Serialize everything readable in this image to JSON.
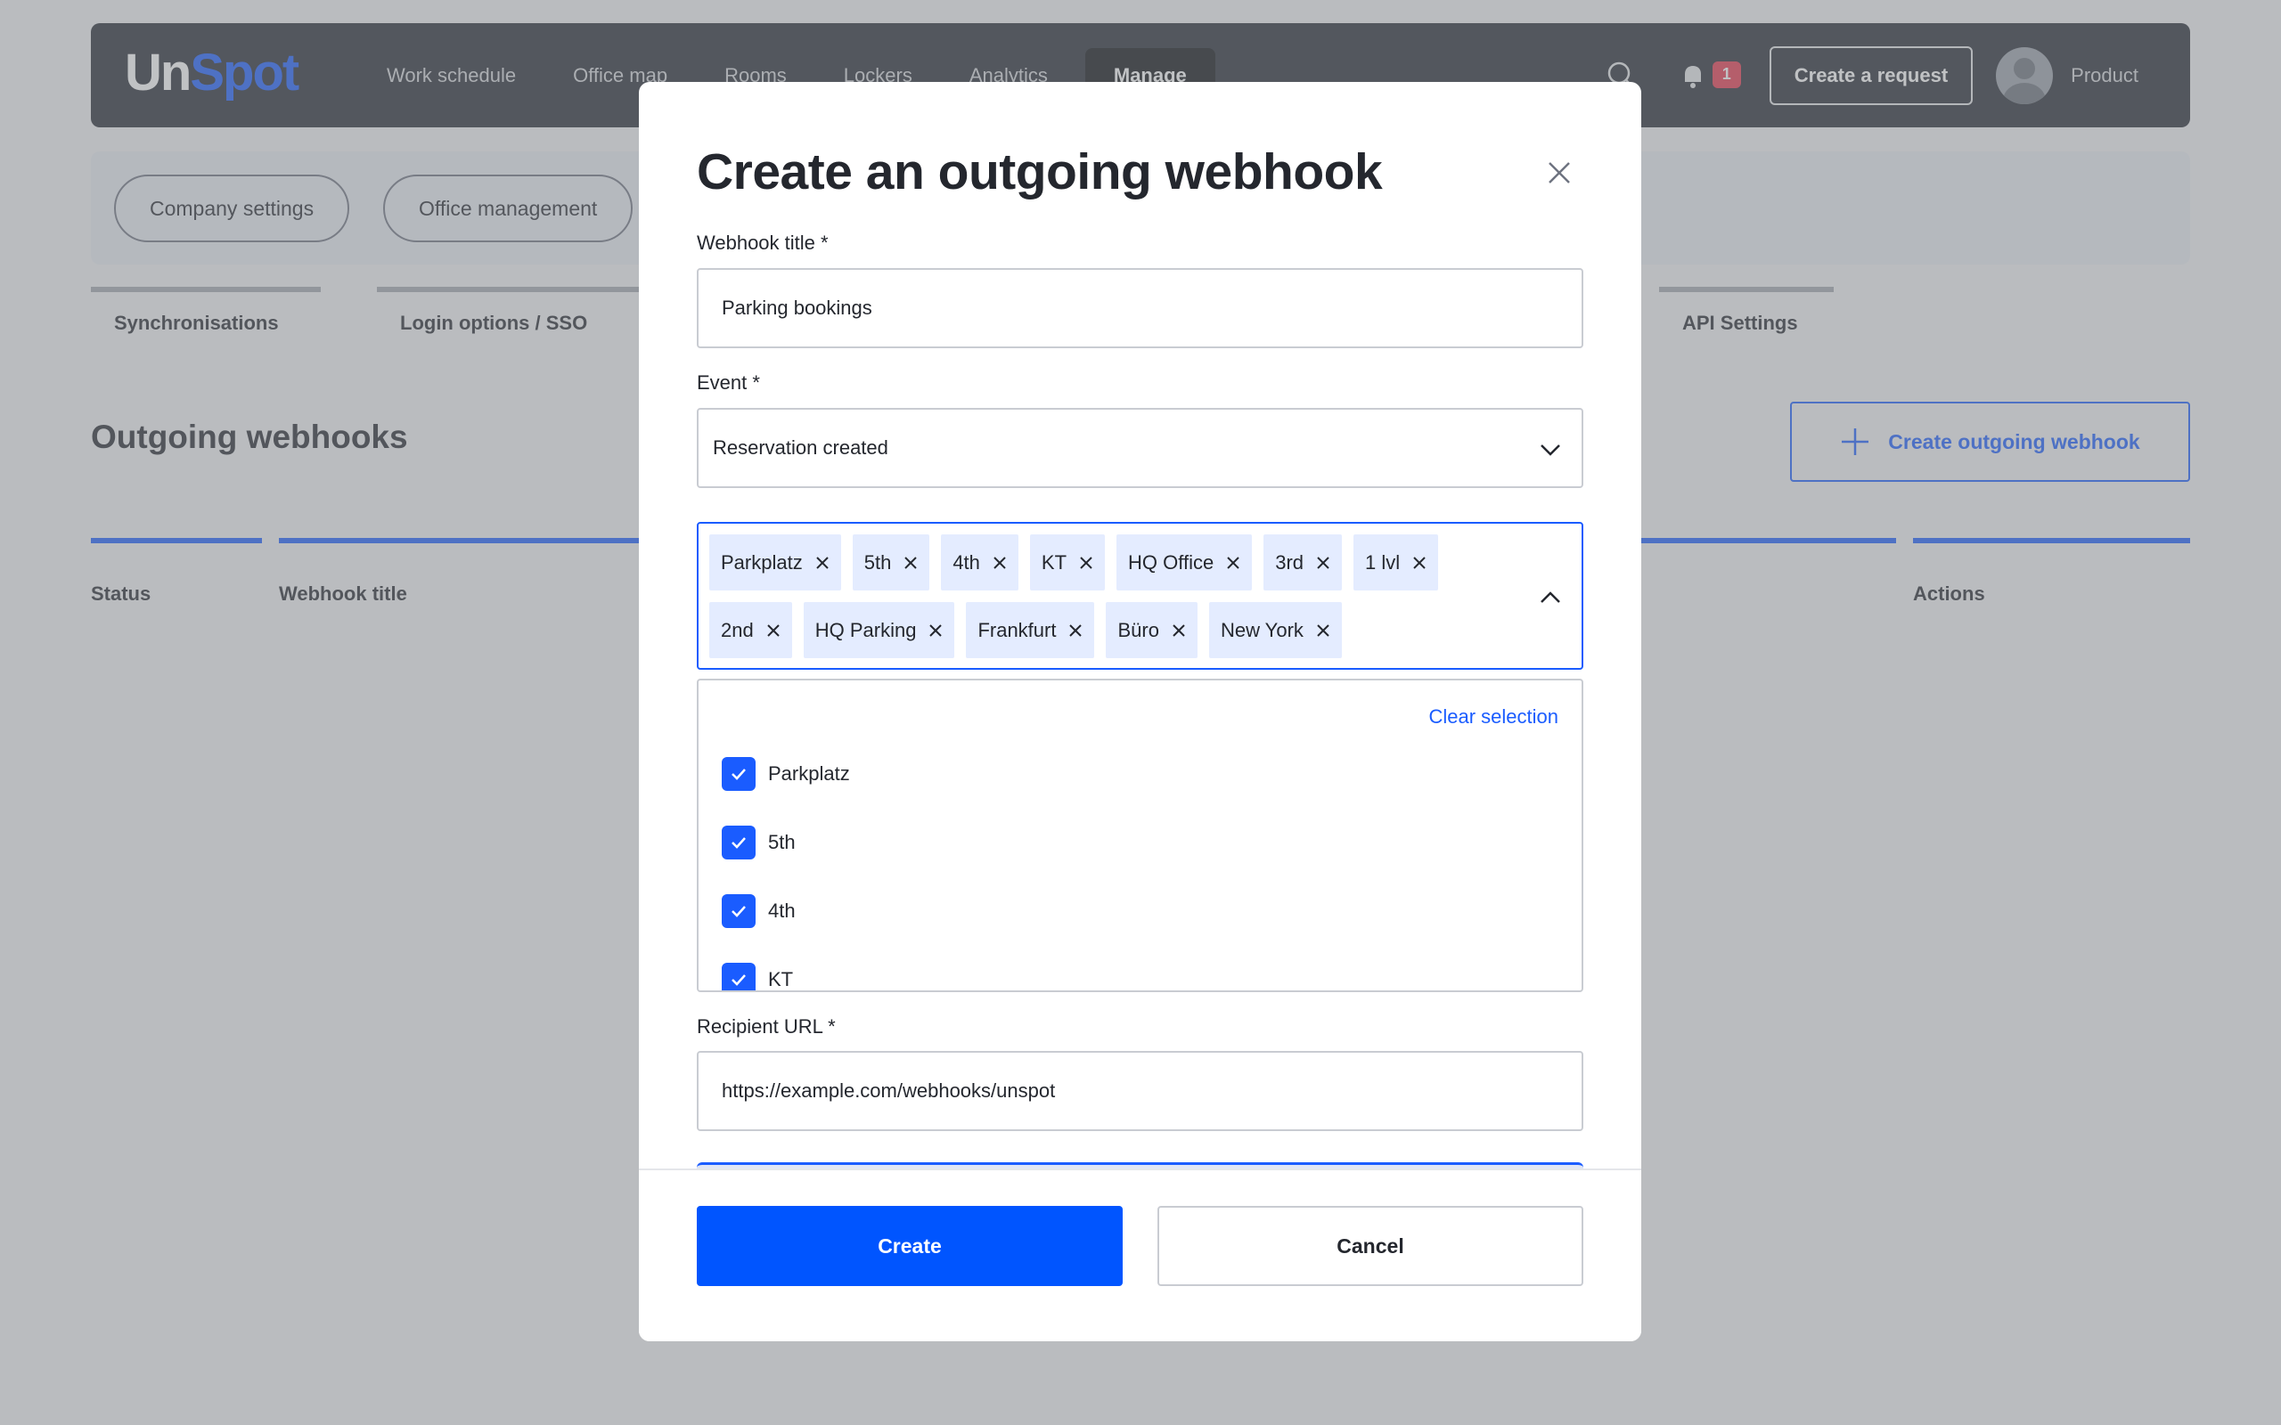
{
  "app": {
    "logo_un": "Un",
    "logo_spot": "Spot",
    "nav": [
      "Work schedule",
      "Office map",
      "Rooms",
      "Lockers",
      "Analytics",
      "Manage"
    ],
    "notification_count": "1",
    "create_request": "Create a request",
    "user_name": "Product",
    "subnav": [
      "Company settings",
      "Office management"
    ],
    "tabs": [
      "Synchronisations",
      "Login options / SSO",
      "API Settings"
    ],
    "section_title": "Outgoing webhooks",
    "create_webhook": "Create outgoing webhook",
    "columns": [
      "Status",
      "Webhook title",
      "Actions"
    ]
  },
  "modal": {
    "title": "Create an outgoing webhook",
    "webhook_title_label": "Webhook title *",
    "webhook_title_value": "Parking bookings",
    "event_label": "Event *",
    "event_value": "Reservation created",
    "chips": [
      "Parkplatz",
      "5th",
      "4th",
      "KT",
      "HQ Office",
      "3rd",
      "1 lvl",
      "2nd",
      "HQ Parking",
      "Frankfurt",
      "Büro",
      "New York"
    ],
    "clear_selection": "Clear selection",
    "options": [
      "Parkplatz",
      "5th",
      "4th",
      "KT"
    ],
    "recipient_label": "Recipient URL *",
    "recipient_value": "https://example.com/webhooks/unspot",
    "create": "Create",
    "cancel": "Cancel"
  },
  "colors": {
    "accent": "#0055ff",
    "topbar": "#252932",
    "chip": "#e4ecff",
    "badge": "#e8374d"
  }
}
